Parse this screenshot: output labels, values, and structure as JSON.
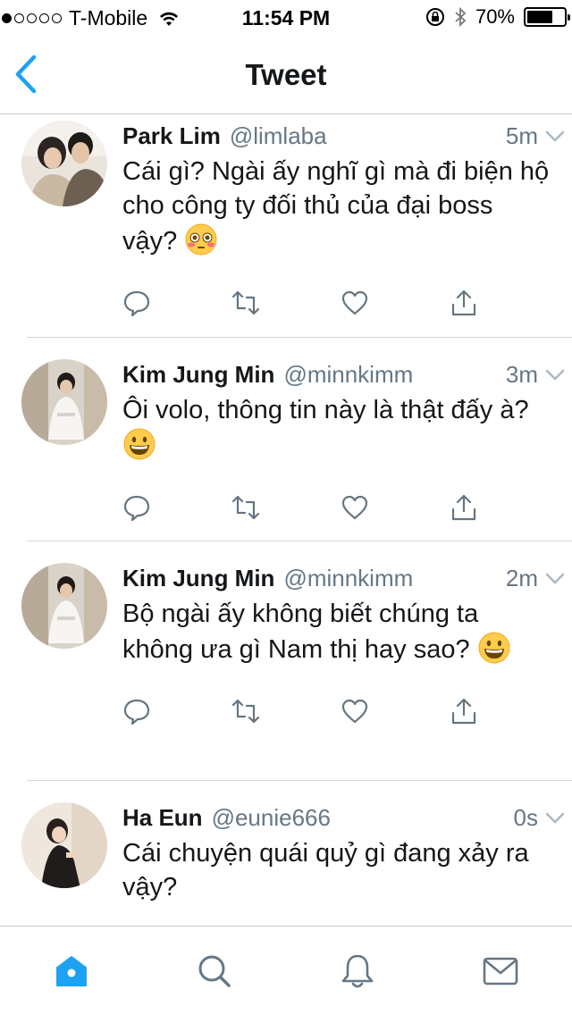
{
  "status_bar": {
    "carrier": "T-Mobile",
    "time": "11:54 PM",
    "battery": "70%",
    "battery_level": 0.7
  },
  "nav": {
    "title": "Tweet"
  },
  "accent_color": "#1da1f2",
  "tweets": [
    {
      "name": "Park Lim",
      "handle": "@limlaba",
      "age": "5m",
      "text": "Cái gì? Ngài ấy nghĩ gì mà đi biện hộ cho công ty đối thủ của đại boss vậy?",
      "emoji": "flushed-face"
    },
    {
      "name": "Kim Jung Min",
      "handle": "@minnkimm",
      "age": "3m",
      "text": "Ôi volo, thông tin này là thật đấy à?",
      "emoji": "grinning-face"
    },
    {
      "name": "Kim Jung Min",
      "handle": "@minnkimm",
      "age": "2m",
      "text": "Bộ ngài ấy không biết chúng ta không ưa gì Nam thị hay sao?",
      "emoji": "grinning-face"
    },
    {
      "name": "Ha Eun",
      "handle": "@eunie666",
      "age": "0s",
      "text": "Cái chuyện quái quỷ gì đang xảy ra vậy?",
      "emoji": ""
    }
  ],
  "tab_bar": {
    "items": [
      "home-icon",
      "search-icon",
      "notifications-icon",
      "messages-icon"
    ],
    "active": "home-icon"
  }
}
